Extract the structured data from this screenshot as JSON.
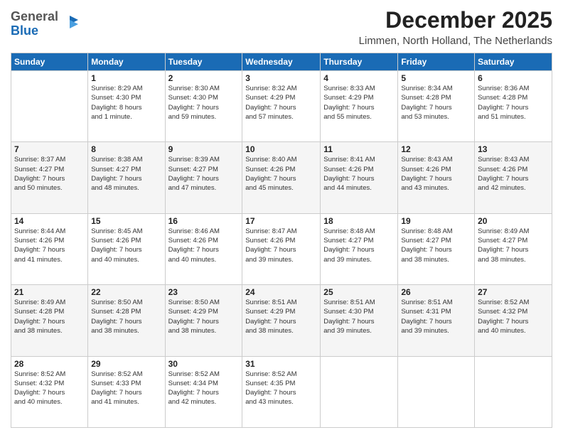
{
  "logo": {
    "general": "General",
    "blue": "Blue"
  },
  "header": {
    "month_year": "December 2025",
    "location": "Limmen, North Holland, The Netherlands"
  },
  "weekdays": [
    "Sunday",
    "Monday",
    "Tuesday",
    "Wednesday",
    "Thursday",
    "Friday",
    "Saturday"
  ],
  "weeks": [
    [
      {
        "day": "",
        "info": ""
      },
      {
        "day": "1",
        "info": "Sunrise: 8:29 AM\nSunset: 4:30 PM\nDaylight: 8 hours\nand 1 minute."
      },
      {
        "day": "2",
        "info": "Sunrise: 8:30 AM\nSunset: 4:30 PM\nDaylight: 7 hours\nand 59 minutes."
      },
      {
        "day": "3",
        "info": "Sunrise: 8:32 AM\nSunset: 4:29 PM\nDaylight: 7 hours\nand 57 minutes."
      },
      {
        "day": "4",
        "info": "Sunrise: 8:33 AM\nSunset: 4:29 PM\nDaylight: 7 hours\nand 55 minutes."
      },
      {
        "day": "5",
        "info": "Sunrise: 8:34 AM\nSunset: 4:28 PM\nDaylight: 7 hours\nand 53 minutes."
      },
      {
        "day": "6",
        "info": "Sunrise: 8:36 AM\nSunset: 4:28 PM\nDaylight: 7 hours\nand 51 minutes."
      }
    ],
    [
      {
        "day": "7",
        "info": "Sunrise: 8:37 AM\nSunset: 4:27 PM\nDaylight: 7 hours\nand 50 minutes."
      },
      {
        "day": "8",
        "info": "Sunrise: 8:38 AM\nSunset: 4:27 PM\nDaylight: 7 hours\nand 48 minutes."
      },
      {
        "day": "9",
        "info": "Sunrise: 8:39 AM\nSunset: 4:27 PM\nDaylight: 7 hours\nand 47 minutes."
      },
      {
        "day": "10",
        "info": "Sunrise: 8:40 AM\nSunset: 4:26 PM\nDaylight: 7 hours\nand 45 minutes."
      },
      {
        "day": "11",
        "info": "Sunrise: 8:41 AM\nSunset: 4:26 PM\nDaylight: 7 hours\nand 44 minutes."
      },
      {
        "day": "12",
        "info": "Sunrise: 8:43 AM\nSunset: 4:26 PM\nDaylight: 7 hours\nand 43 minutes."
      },
      {
        "day": "13",
        "info": "Sunrise: 8:43 AM\nSunset: 4:26 PM\nDaylight: 7 hours\nand 42 minutes."
      }
    ],
    [
      {
        "day": "14",
        "info": "Sunrise: 8:44 AM\nSunset: 4:26 PM\nDaylight: 7 hours\nand 41 minutes."
      },
      {
        "day": "15",
        "info": "Sunrise: 8:45 AM\nSunset: 4:26 PM\nDaylight: 7 hours\nand 40 minutes."
      },
      {
        "day": "16",
        "info": "Sunrise: 8:46 AM\nSunset: 4:26 PM\nDaylight: 7 hours\nand 40 minutes."
      },
      {
        "day": "17",
        "info": "Sunrise: 8:47 AM\nSunset: 4:26 PM\nDaylight: 7 hours\nand 39 minutes."
      },
      {
        "day": "18",
        "info": "Sunrise: 8:48 AM\nSunset: 4:27 PM\nDaylight: 7 hours\nand 39 minutes."
      },
      {
        "day": "19",
        "info": "Sunrise: 8:48 AM\nSunset: 4:27 PM\nDaylight: 7 hours\nand 38 minutes."
      },
      {
        "day": "20",
        "info": "Sunrise: 8:49 AM\nSunset: 4:27 PM\nDaylight: 7 hours\nand 38 minutes."
      }
    ],
    [
      {
        "day": "21",
        "info": "Sunrise: 8:49 AM\nSunset: 4:28 PM\nDaylight: 7 hours\nand 38 minutes."
      },
      {
        "day": "22",
        "info": "Sunrise: 8:50 AM\nSunset: 4:28 PM\nDaylight: 7 hours\nand 38 minutes."
      },
      {
        "day": "23",
        "info": "Sunrise: 8:50 AM\nSunset: 4:29 PM\nDaylight: 7 hours\nand 38 minutes."
      },
      {
        "day": "24",
        "info": "Sunrise: 8:51 AM\nSunset: 4:29 PM\nDaylight: 7 hours\nand 38 minutes."
      },
      {
        "day": "25",
        "info": "Sunrise: 8:51 AM\nSunset: 4:30 PM\nDaylight: 7 hours\nand 39 minutes."
      },
      {
        "day": "26",
        "info": "Sunrise: 8:51 AM\nSunset: 4:31 PM\nDaylight: 7 hours\nand 39 minutes."
      },
      {
        "day": "27",
        "info": "Sunrise: 8:52 AM\nSunset: 4:32 PM\nDaylight: 7 hours\nand 40 minutes."
      }
    ],
    [
      {
        "day": "28",
        "info": "Sunrise: 8:52 AM\nSunset: 4:32 PM\nDaylight: 7 hours\nand 40 minutes."
      },
      {
        "day": "29",
        "info": "Sunrise: 8:52 AM\nSunset: 4:33 PM\nDaylight: 7 hours\nand 41 minutes."
      },
      {
        "day": "30",
        "info": "Sunrise: 8:52 AM\nSunset: 4:34 PM\nDaylight: 7 hours\nand 42 minutes."
      },
      {
        "day": "31",
        "info": "Sunrise: 8:52 AM\nSunset: 4:35 PM\nDaylight: 7 hours\nand 43 minutes."
      },
      {
        "day": "",
        "info": ""
      },
      {
        "day": "",
        "info": ""
      },
      {
        "day": "",
        "info": ""
      }
    ]
  ]
}
